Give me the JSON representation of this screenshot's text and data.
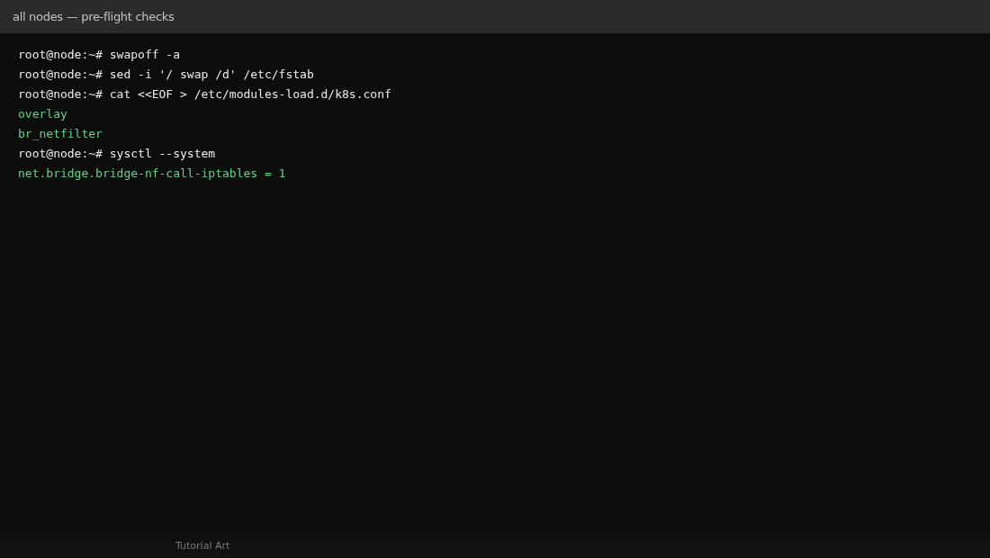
{
  "window": {
    "title": "all nodes — pre-flight checks"
  },
  "terminal": {
    "lines": [
      {
        "kind": "command",
        "prompt": "root@node:~#",
        "text": "swapoff -a"
      },
      {
        "kind": "command",
        "prompt": "root@node:~#",
        "text": "sed -i '/ swap /d' /etc/fstab"
      },
      {
        "kind": "command",
        "prompt": "root@node:~#",
        "text": "cat <<EOF > /etc/modules-load.d/k8s.conf"
      },
      {
        "kind": "output",
        "text": "overlay"
      },
      {
        "kind": "output",
        "text": "br_netfilter"
      },
      {
        "kind": "command",
        "prompt": "root@node:~#",
        "text": "sysctl --system"
      },
      {
        "kind": "output",
        "text": "net.bridge.bridge-nf-call-iptables = 1"
      }
    ]
  },
  "footer": {
    "caption": "Tutorial Art"
  }
}
